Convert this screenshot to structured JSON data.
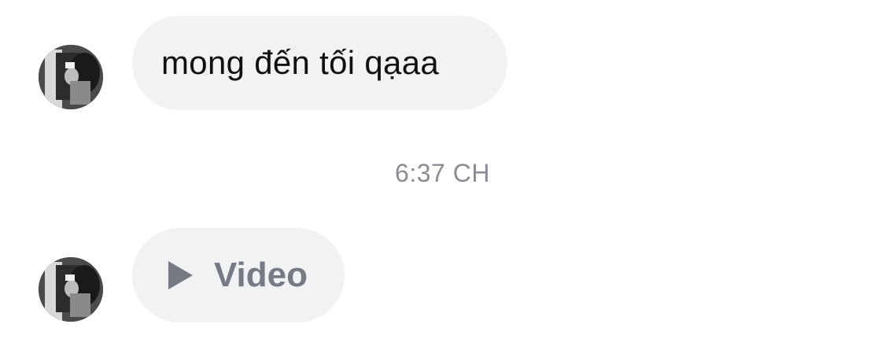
{
  "messages": [
    {
      "type": "text",
      "text": "mong đến tối qạaa",
      "avatar_icon": "user-avatar-icon"
    },
    {
      "type": "video",
      "label": "Video",
      "icon": "play-icon",
      "avatar_icon": "user-avatar-icon"
    }
  ],
  "timestamp": "6:37 CH",
  "colors": {
    "bubble": "#f1f2f4",
    "text": "#111111",
    "muted": "#757a83",
    "timestamp": "#8a8d93"
  }
}
